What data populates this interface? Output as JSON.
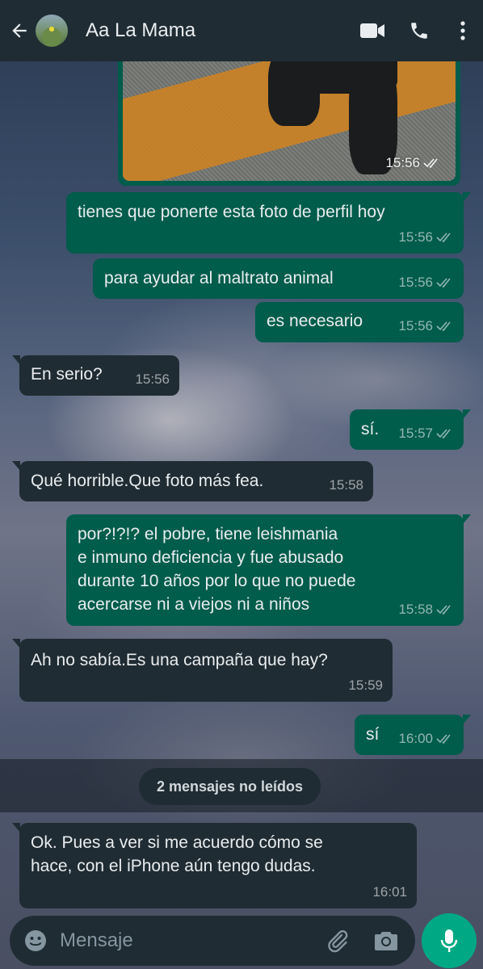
{
  "header": {
    "contact_name": "Aa La Mama",
    "icons": [
      "back-arrow-icon",
      "video-call-icon",
      "phone-call-icon",
      "more-options-icon"
    ]
  },
  "messages": [
    {
      "type": "image",
      "direction": "outgoing",
      "time": "15:56",
      "status": "read"
    },
    {
      "direction": "outgoing",
      "text": "tienes que ponerte esta foto de perfil hoy",
      "time": "15:56",
      "status": "read"
    },
    {
      "direction": "outgoing",
      "text": "para ayudar al maltrato animal",
      "time": "15:56",
      "status": "read"
    },
    {
      "direction": "outgoing",
      "text": "es necesario",
      "time": "15:56",
      "status": "read"
    },
    {
      "direction": "incoming",
      "text": "En serio?",
      "time": "15:56"
    },
    {
      "direction": "outgoing",
      "text": "sí.",
      "time": "15:57",
      "status": "read"
    },
    {
      "direction": "incoming",
      "text": "Qué horrible.Que foto más fea.",
      "time": "15:58"
    },
    {
      "direction": "outgoing",
      "lines": [
        "por?!?!? el pobre, tiene leishmania",
        "e inmuno deficiencia y fue abusado",
        "durante 10 años por lo que no puede",
        "acercarse ni a viejos ni a niños"
      ],
      "time": "15:58",
      "status": "read"
    },
    {
      "direction": "incoming",
      "text": "Ah no sabía.Es una campaña que hay?",
      "time": "15:59"
    },
    {
      "direction": "outgoing",
      "text": "sí",
      "time": "16:00",
      "status": "read"
    },
    {
      "direction": "incoming",
      "lines": [
        "Ok. Pues a ver si me acuerdo cómo se",
        "hace, con el iPhone aún tengo dudas."
      ],
      "time": "16:01"
    }
  ],
  "unread_banner": "2 mensajes no leídos",
  "composer": {
    "placeholder": "Mensaje",
    "icons": [
      "emoji-icon",
      "attach-icon",
      "camera-icon",
      "mic-icon"
    ]
  },
  "colors": {
    "header_bg": "#1f2c34",
    "outgoing_bubble": "#005c4b",
    "incoming_bubble": "#202c33",
    "accent": "#00a884"
  }
}
